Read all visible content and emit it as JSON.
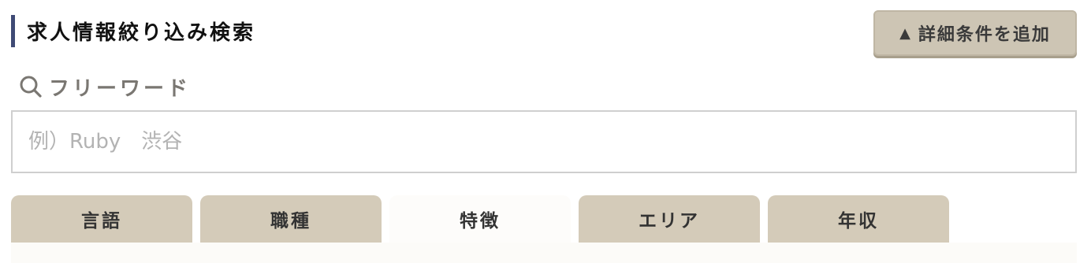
{
  "header": {
    "title": "求人情報絞り込み検索"
  },
  "add_button": {
    "icon": "▲",
    "label": "詳細条件を追加"
  },
  "freeword": {
    "label": "フリーワード",
    "placeholder": "例）Ruby　渋谷",
    "value": ""
  },
  "tabs": [
    {
      "label": "言語",
      "active": false
    },
    {
      "label": "職種",
      "active": false
    },
    {
      "label": "特徴",
      "active": true
    },
    {
      "label": "エリア",
      "active": false
    },
    {
      "label": "年収",
      "active": false
    }
  ],
  "colors": {
    "header_bar": "#3f4a75",
    "tab_bg": "#d4cbb9",
    "tab_active_bg": "#fdfcfa",
    "button_bg": "#cdc5b4"
  }
}
